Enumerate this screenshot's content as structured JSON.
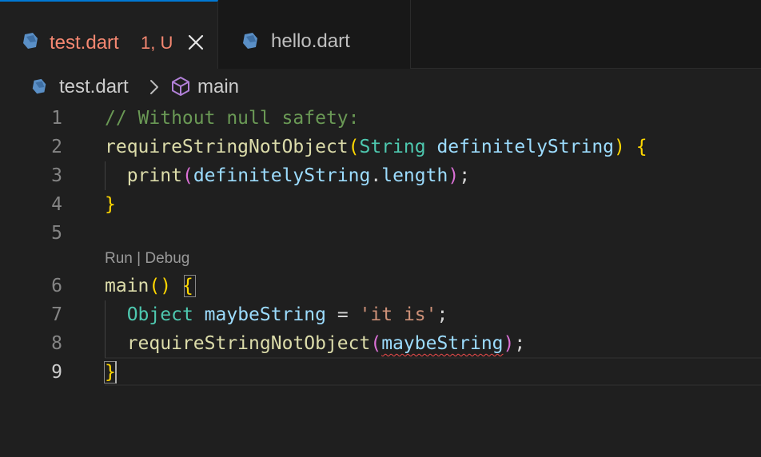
{
  "tabs": [
    {
      "title": "test.dart",
      "status": "1, U",
      "active": true,
      "icon": "dart-file-icon"
    },
    {
      "title": "hello.dart",
      "active": false,
      "icon": "dart-file-icon"
    }
  ],
  "breadcrumb": {
    "file": "test.dart",
    "symbol": "main",
    "symbol_icon": "cube-icon"
  },
  "codelens": "Run | Debug",
  "line_numbers": [
    "1",
    "2",
    "3",
    "4",
    "5",
    "6",
    "7",
    "8",
    "9"
  ],
  "code": {
    "l1": {
      "comment": "// Without null safety:"
    },
    "l2": {
      "func": "requireStringNotObject",
      "open_paren": "(",
      "type": "String",
      "param": "definitelyString",
      "close_paren": ")",
      "brace": "{"
    },
    "l3": {
      "func": "print",
      "open_paren": "(",
      "var": "definitelyString",
      "dot": ".",
      "prop": "length",
      "close_paren": ")",
      "semi": ";"
    },
    "l4": {
      "brace": "}"
    },
    "l6": {
      "func": "main",
      "parens": "()",
      "brace": "{"
    },
    "l7": {
      "type": "Object",
      "var": "maybeString",
      "op": "=",
      "str": "'it is'",
      "semi": ";"
    },
    "l8": {
      "func": "requireStringNotObject",
      "open_paren": "(",
      "arg": "maybeString",
      "close_paren": ")",
      "semi": ";"
    },
    "l9": {
      "brace": "}"
    }
  },
  "colors": {
    "accent": "#0078d4",
    "modified_tab_text": "#f48771",
    "comment": "#6a9955",
    "function": "#dcdcaa",
    "type": "#4ec9b0",
    "variable": "#9cdcfe",
    "string": "#ce9178",
    "bracket_level1": "#ffd700",
    "bracket_level2": "#da70d6",
    "error_squiggle": "#f14c4c"
  }
}
